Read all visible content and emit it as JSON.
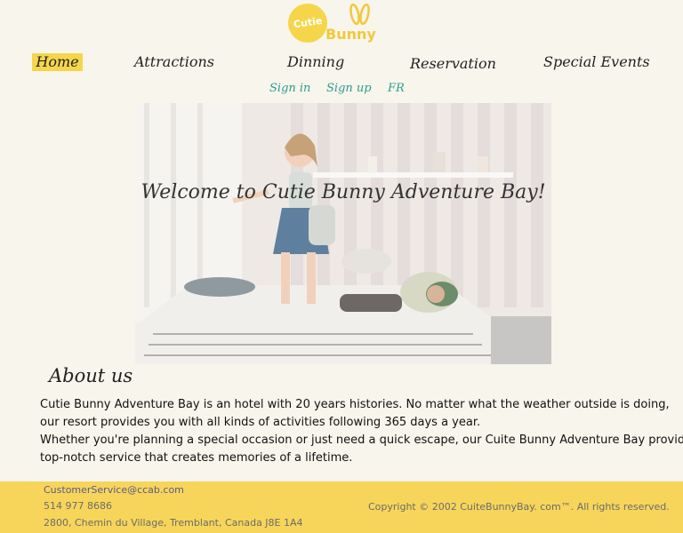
{
  "brand": {
    "logo_top": "Cutie",
    "logo_bottom": "Bunny",
    "accent": "#f5d64a"
  },
  "nav": {
    "home": "Home",
    "attractions": "Attractions",
    "dinning": "Dinning",
    "reservation": "Reservation",
    "special_events": "Special Events"
  },
  "subnav": {
    "signin": "Sign in",
    "signup": "Sign up",
    "lang": "FR"
  },
  "hero": {
    "title": "Welcome to Cutie Bunny Adventure Bay!"
  },
  "about": {
    "title": "About us",
    "line1": "Cutie Bunny Adventure Bay is an hotel with 20 years histories. No matter what the weather outside is doing,",
    "line2": "our resort provides you with all kinds of activities following 365 days a year.",
    "line3": "Whether you're planning a special occasion or just need a quick escape, our Cuite Bunny Adventure Bay provides",
    "line4": "top-notch service that creates memories of a lifetime."
  },
  "footer": {
    "email": "CustomerService@ccab.com",
    "phone": "514 977 8686",
    "address": "2800, Chemin du Village, Tremblant, Canada J8E 1A4",
    "copyright": "Copyright © 2002 CuiteBunnyBay. com™. All rights reserved."
  }
}
